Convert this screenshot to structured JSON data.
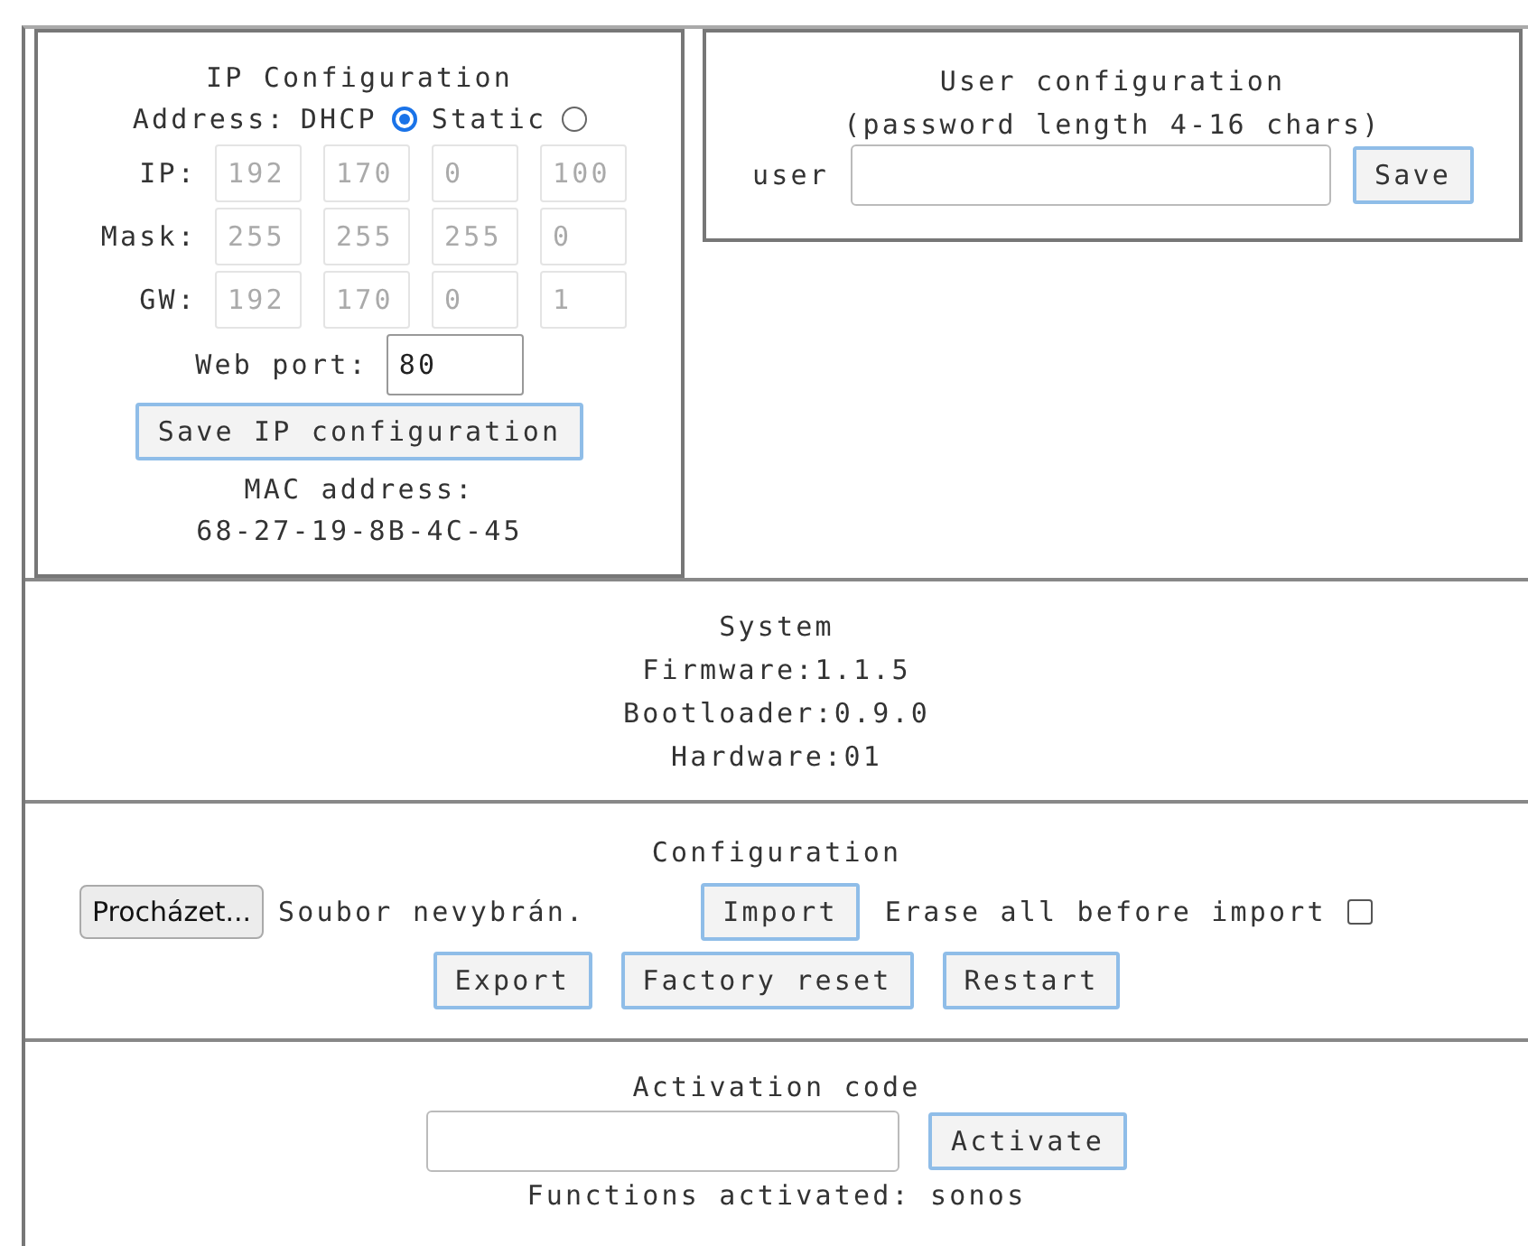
{
  "ip_config": {
    "title": "IP Configuration",
    "address_label": "Address:",
    "modes": [
      {
        "label": "DHCP",
        "selected": true
      },
      {
        "label": "Static",
        "selected": false
      }
    ],
    "rows": [
      {
        "label": "IP:",
        "disabled": true,
        "octets": [
          "192",
          "170",
          "0",
          "100"
        ]
      },
      {
        "label": "Mask:",
        "disabled": true,
        "octets": [
          "255",
          "255",
          "255",
          "0"
        ]
      },
      {
        "label": "GW:",
        "disabled": true,
        "octets": [
          "192",
          "170",
          "0",
          "1"
        ]
      }
    ],
    "web_port": {
      "label": "Web port:",
      "value": "80"
    },
    "save_button": "Save IP configuration",
    "mac_label": "MAC address:",
    "mac_value": "68-27-19-8B-4C-45"
  },
  "user_config": {
    "title": "User configuration",
    "subtitle": "(password length 4-16 chars)",
    "field_label": "user",
    "save_button": "Save"
  },
  "system": {
    "title": "System",
    "lines": [
      "Firmware:1.1.5",
      "Bootloader:0.9.0",
      "Hardware:01"
    ]
  },
  "configuration": {
    "title": "Configuration",
    "browse_button": "Procházet...",
    "file_status": "Soubor nevybrán.",
    "import_button": "Import",
    "erase_label": "Erase all before import",
    "erase_checked": false,
    "buttons": [
      "Export",
      "Factory reset",
      "Restart"
    ]
  },
  "activation": {
    "title": "Activation code",
    "button": "Activate",
    "status": "Functions activated: sonos"
  }
}
